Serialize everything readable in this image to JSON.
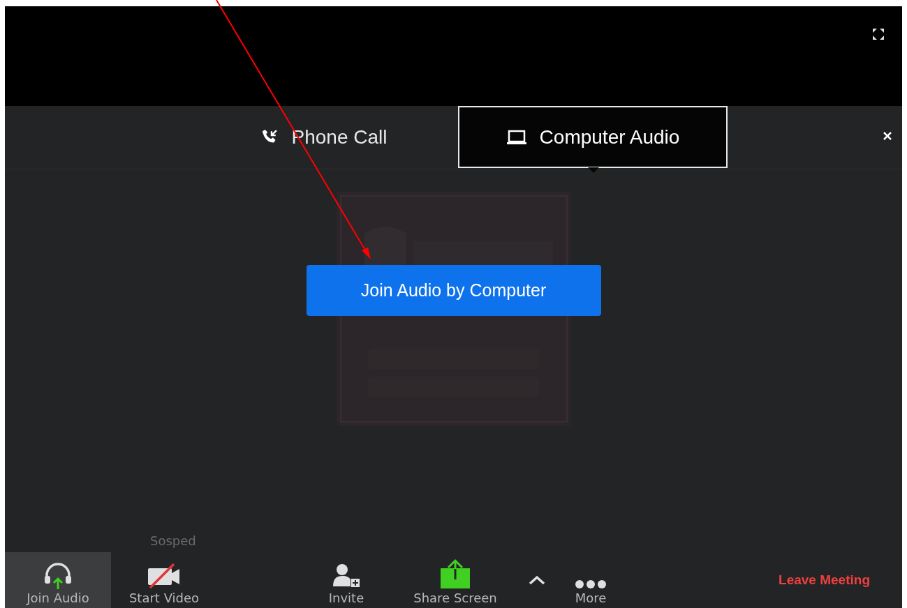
{
  "tabs": [
    {
      "label": "Phone Call",
      "kind": "phone",
      "selected": false
    },
    {
      "label": "Computer Audio",
      "kind": "computer",
      "selected": true
    }
  ],
  "join_button": "Join Audio by Computer",
  "video_tile": {
    "kind": "picture",
    "participant_name": "Sosped"
  },
  "toolbar": [
    {
      "label": "Join Audio",
      "kind": "audio",
      "highlighted": true
    },
    {
      "label": "Start Video",
      "kind": "video",
      "highlighted": false
    },
    {
      "label": "Invite",
      "kind": "invite",
      "highlighted": false
    },
    {
      "label": "Share Screen",
      "kind": "share",
      "highlighted": false
    },
    {
      "kind": "options",
      "highlighted": false
    },
    {
      "label": "More",
      "kind": "more",
      "highlighted": false
    }
  ],
  "leave_button": "Leave Meeting"
}
